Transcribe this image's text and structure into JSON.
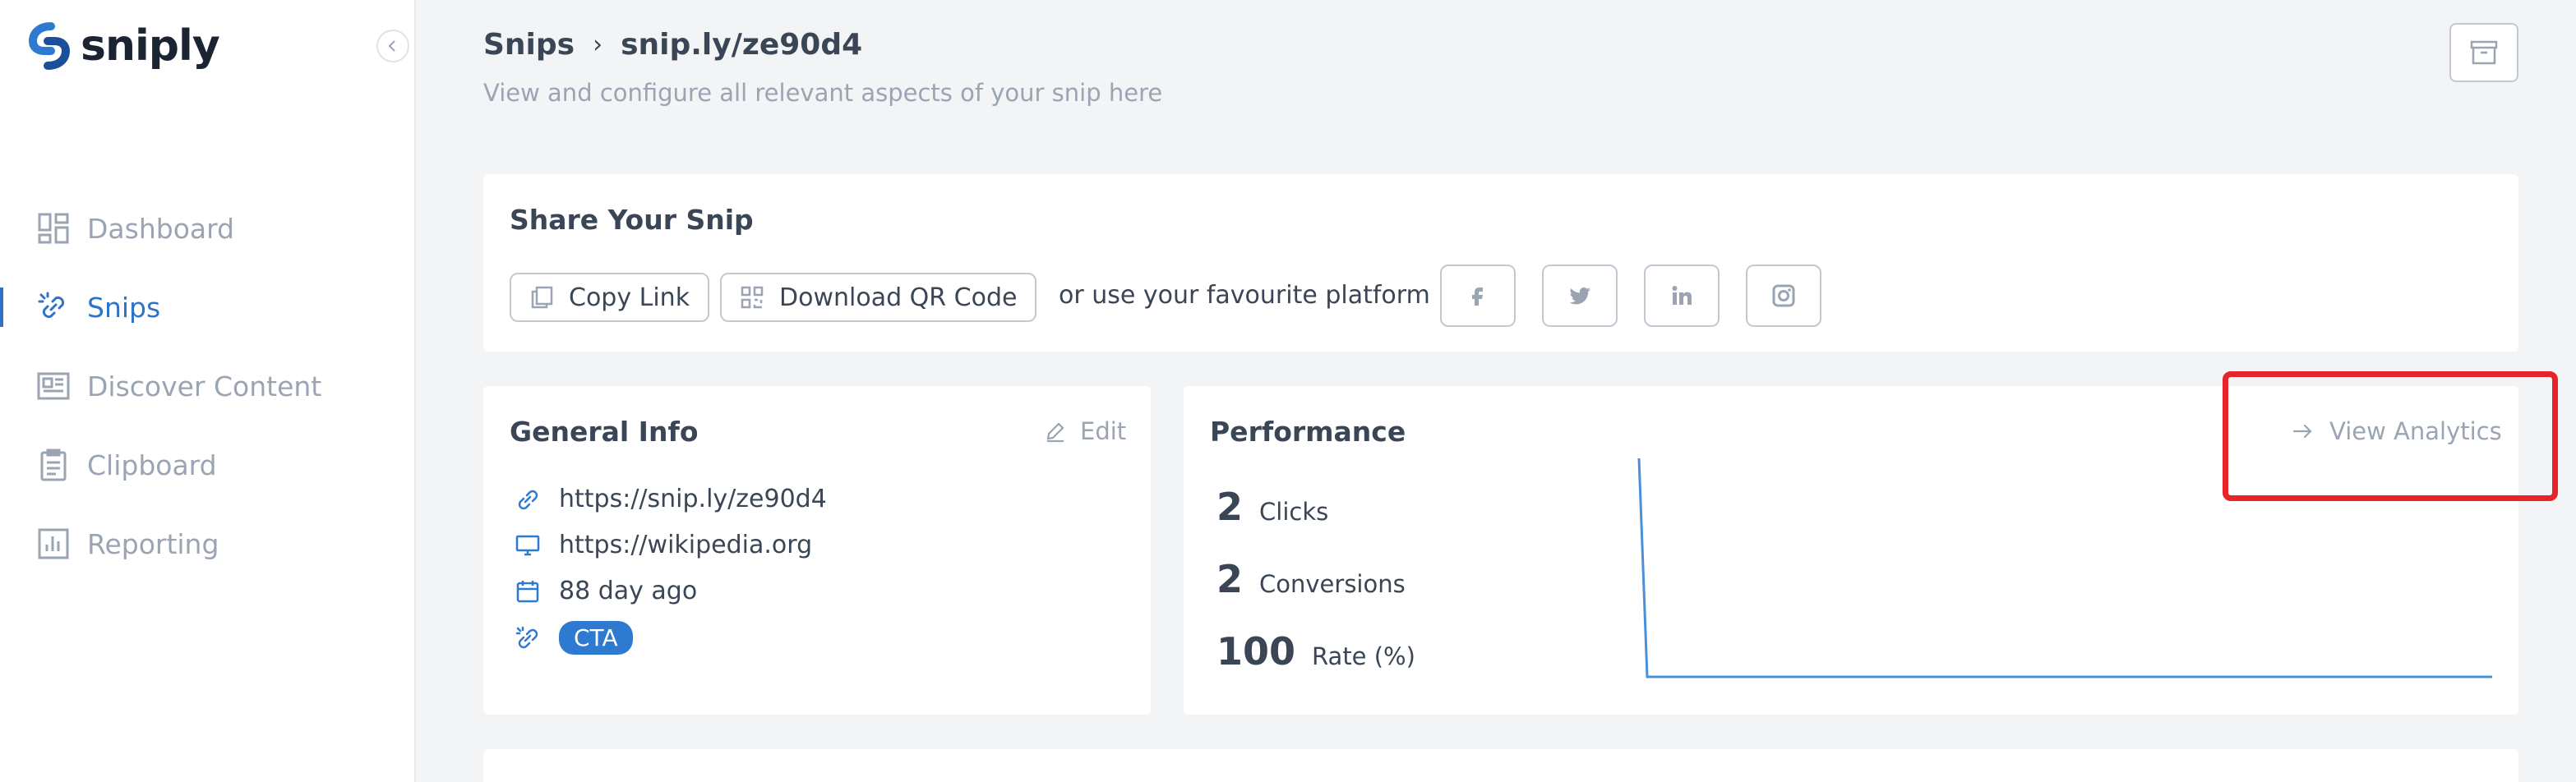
{
  "app": {
    "logo_text": "sniply"
  },
  "sidebar": {
    "items": [
      {
        "label": "Dashboard",
        "icon": "dashboard-icon",
        "active": false
      },
      {
        "label": "Snips",
        "icon": "link-icon",
        "active": true
      },
      {
        "label": "Discover Content",
        "icon": "newspaper-icon",
        "active": false
      },
      {
        "label": "Clipboard",
        "icon": "clipboard-icon",
        "active": false
      },
      {
        "label": "Reporting",
        "icon": "bar-chart-icon",
        "active": false
      }
    ]
  },
  "header": {
    "breadcrumb_root": "Snips",
    "breadcrumb_sep": "›",
    "breadcrumb_current": "snip.ly/ze90d4",
    "subtitle": "View and configure all relevant aspects of your snip here"
  },
  "share": {
    "title": "Share Your Snip",
    "copy_link": "Copy Link",
    "download_qr": "Download QR Code",
    "platform_text": "or use your favourite platform",
    "platforms": [
      "facebook-icon",
      "twitter-icon",
      "linkedin-icon",
      "instagram-icon"
    ]
  },
  "general": {
    "title": "General Info",
    "edit_label": "Edit",
    "snip_url": "https://snip.ly/ze90d4",
    "target_url": "https://wikipedia.org",
    "created": "88 day ago",
    "badge": "CTA"
  },
  "performance": {
    "title": "Performance",
    "view_analytics": "View Analytics",
    "clicks_value": "2",
    "clicks_label": "Clicks",
    "conversions_value": "2",
    "conversions_label": "Conversions",
    "rate_value": "100",
    "rate_label": "Rate (%)"
  },
  "colors": {
    "accent": "#2f72c8",
    "highlight": "#e8242b",
    "muted": "#9aa4b2"
  }
}
